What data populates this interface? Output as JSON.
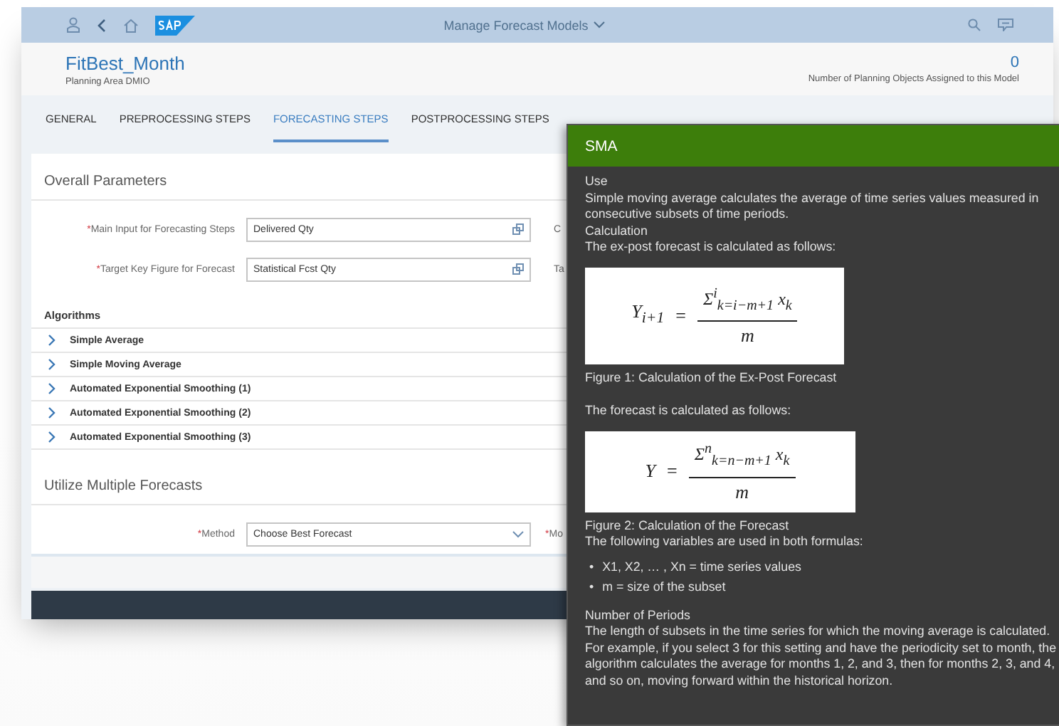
{
  "shell_bar": {
    "title": "Manage Forecast Models"
  },
  "header": {
    "title": "FitBest_Month",
    "subtitle": "Planning Area DMIO",
    "count": "0",
    "count_label": "Number of Planning Objects Assigned to this Model"
  },
  "tabs": [
    {
      "label": "GENERAL",
      "selected": false
    },
    {
      "label": "PREPROCESSING STEPS",
      "selected": false
    },
    {
      "label": "FORECASTING STEPS",
      "selected": true
    },
    {
      "label": "POSTPROCESSING STEPS",
      "selected": false
    }
  ],
  "overall_parameters": {
    "title": "Overall Parameters",
    "fields": [
      {
        "required_mark": "*",
        "label": "Main Input for Forecasting Steps",
        "value": "Delivered Qty",
        "side_label": "C"
      },
      {
        "required_mark": "*",
        "label": "Target Key Figure for Forecast",
        "value": "Statistical Fcst Qty",
        "side_label": "Ta"
      }
    ]
  },
  "algorithms": {
    "title": "Algorithms",
    "items": [
      {
        "label": "Simple Average",
        "expanded": false
      },
      {
        "label": "Simple Moving Average",
        "expanded": false
      },
      {
        "label": "Automated Exponential Smoothing (1)",
        "expanded": false
      },
      {
        "label": "Automated Exponential Smoothing (2)",
        "expanded": false
      },
      {
        "label": "Automated Exponential Smoothing (3)",
        "expanded": false
      }
    ]
  },
  "multiple_forecasts": {
    "title": "Utilize Multiple Forecasts",
    "fields": [
      {
        "required_mark": "*",
        "label": "Method",
        "value": "Choose Best Forecast",
        "side_mark": "*",
        "side_label": "Mo"
      }
    ]
  },
  "popover": {
    "title": "SMA",
    "blocks": [
      {
        "kind": "heading",
        "text": "Use"
      },
      {
        "kind": "paragraph",
        "text": "Simple moving average calculates the average of time series values measured in consecutive subsets of time periods."
      },
      {
        "kind": "heading",
        "text": "Calculation"
      },
      {
        "kind": "paragraph",
        "text": "The ex-post forecast is calculated as follows:"
      },
      {
        "kind": "formula",
        "lhs": "Y$_{i+1}$",
        "equals": "=",
        "numerator": "Σ$^{i}$$_{k=i−m+1}$ x$_{k}$",
        "denominator": "m"
      },
      {
        "kind": "caption",
        "text": "Figure 1: Calculation of the Ex-Post Forecast"
      },
      {
        "kind": "paragraph",
        "text": "The forecast is calculated as follows:"
      },
      {
        "kind": "formula",
        "lhs": "Y",
        "equals": "=",
        "numerator": "Σ$^{n}$$_{k=n−m+1}$ x$_{k}$",
        "denominator": "m"
      },
      {
        "kind": "caption",
        "text": "Figure 2: Calculation of the Forecast"
      },
      {
        "kind": "paragraph",
        "text": "The following variables are used in both formulas:"
      },
      {
        "kind": "bullets",
        "items": [
          {
            "marker": "•",
            "text": "X1, X2, … , Xn = time series values"
          },
          {
            "marker": "•",
            "text": "m = size of the subset"
          }
        ]
      },
      {
        "kind": "heading",
        "text": "Number of Periods"
      },
      {
        "kind": "paragraph",
        "text": "The length of subsets in the time series for which the moving average is calculated. For example, if you select 3 for this setting and have the periodicity set to month, the algorithm calculates the average for months 1, 2, and 3, then for months 2, 3, and 4, and so on, moving forward within the historical horizon."
      }
    ]
  }
}
